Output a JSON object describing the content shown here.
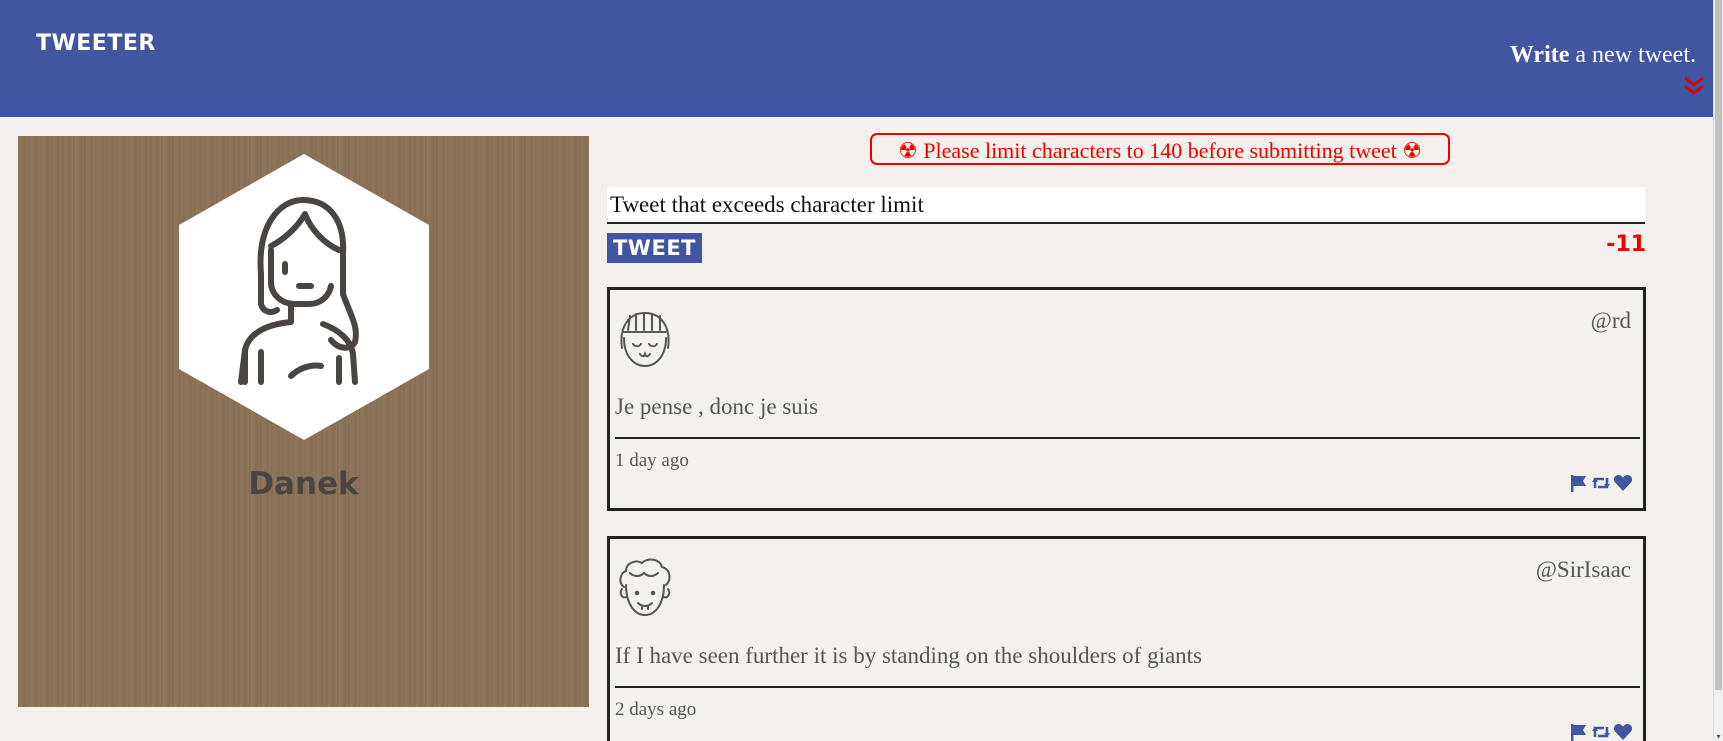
{
  "nav": {
    "brand": "TWEETER",
    "compose_bold": "Write",
    "compose_rest": " a new tweet.",
    "toggle_icon": "double-chevron-down-icon",
    "accent_color": "#4056a1",
    "toggle_icon_color": "#e00000"
  },
  "profile": {
    "name": "Danek",
    "avatar_icon": "woman-avatar-icon"
  },
  "compose": {
    "error_message": "☢ Please limit characters to 140 before submitting tweet ☢",
    "error_color": "#e00000",
    "input_value": "Tweet that exceeds character limit",
    "submit_label": "TWEET",
    "counter": "-11"
  },
  "tweets": [
    {
      "avatar_icon": "girl-bangs-avatar-icon",
      "handle": "@rd",
      "text": "Je pense , donc je suis",
      "time": "1 day ago",
      "actions": [
        "flag-icon",
        "retweet-icon",
        "heart-icon"
      ]
    },
    {
      "avatar_icon": "curly-hair-avatar-icon",
      "handle": "@SirIsaac",
      "text": "If I have seen further it is by standing on the shoulders of giants",
      "time": "2 days ago",
      "actions": [
        "flag-icon",
        "retweet-icon",
        "heart-icon"
      ]
    }
  ]
}
